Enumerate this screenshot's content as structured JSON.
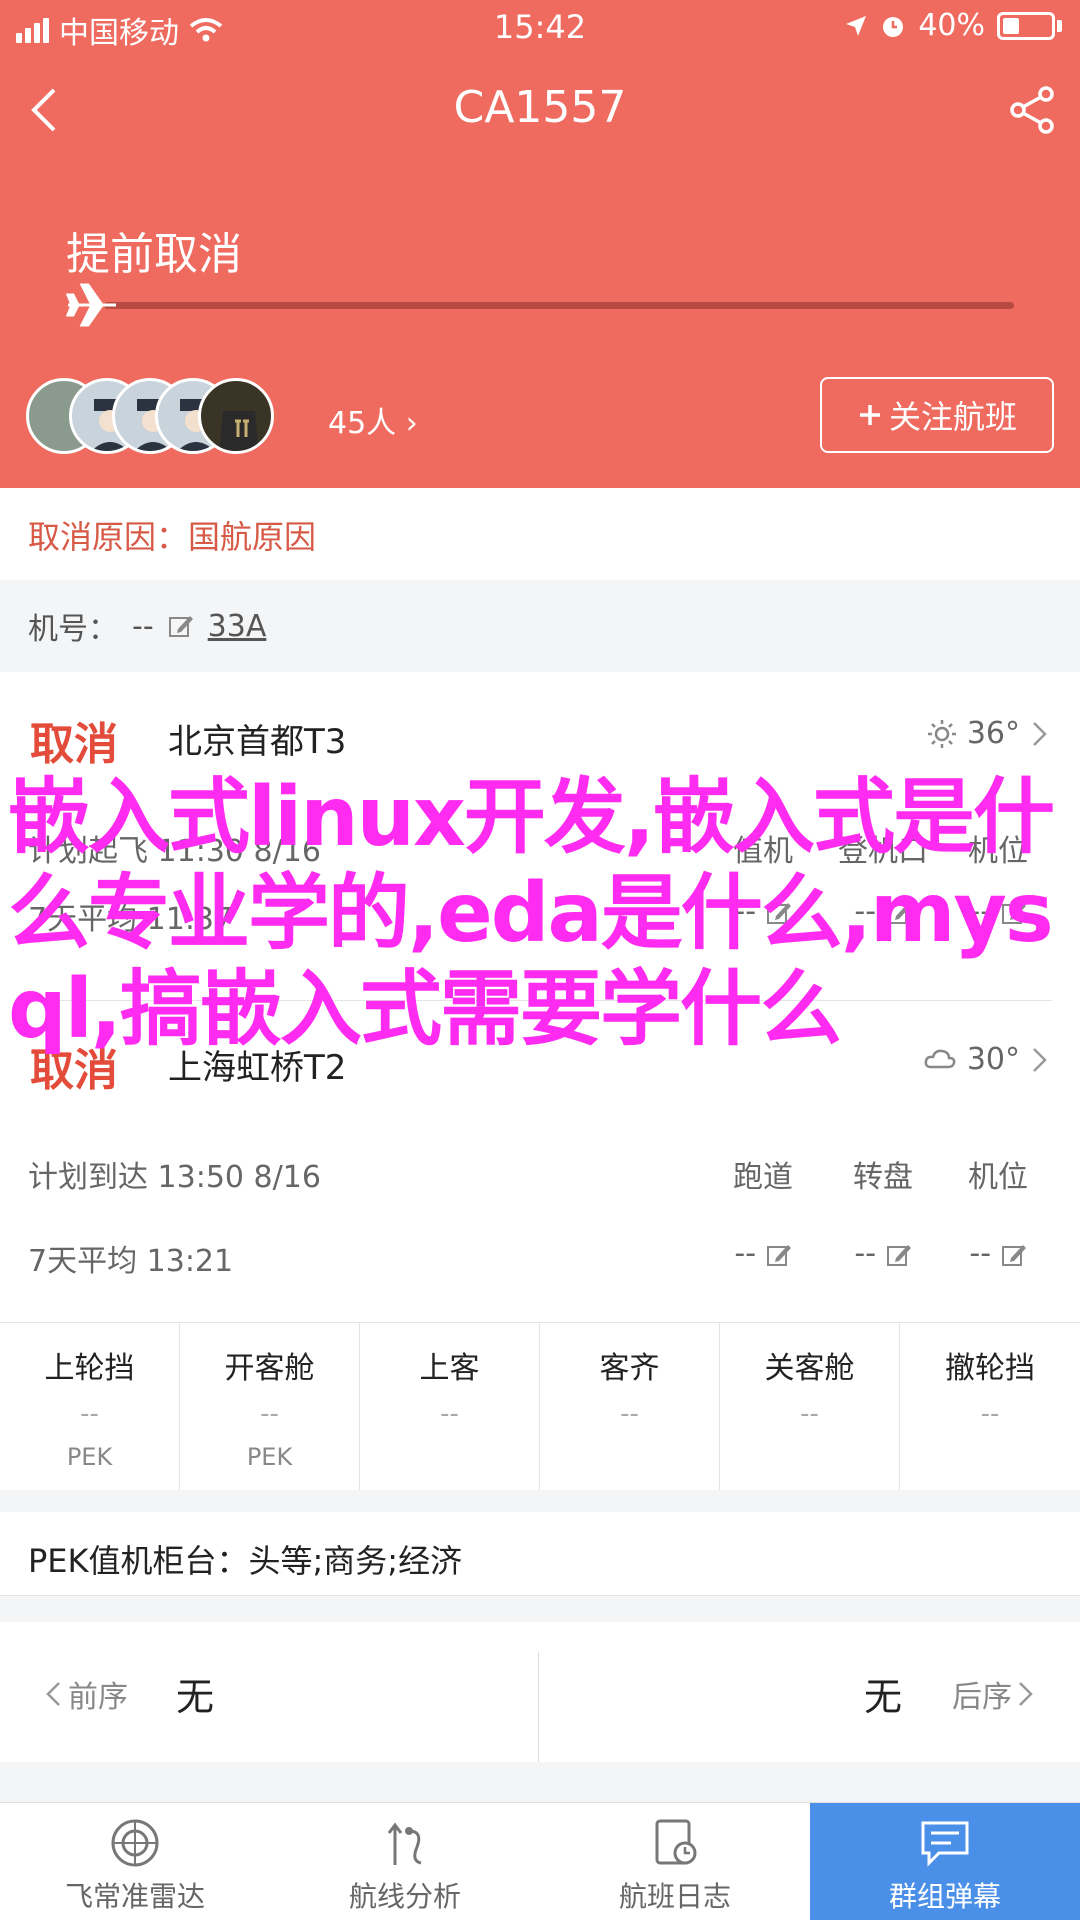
{
  "status_bar": {
    "carrier": "中国移动",
    "time": "15:42",
    "battery": "40%"
  },
  "nav": {
    "title": "CA1557"
  },
  "flight_status": {
    "label": "提前取消"
  },
  "followers": {
    "count_label": "45人",
    "follow_button": "关注航班"
  },
  "cancel_reason": {
    "label": "取消原因：",
    "value": "国航原因"
  },
  "plane_number": {
    "label": "机号：",
    "value": "--",
    "link": "33A"
  },
  "departure": {
    "status": "取消",
    "airport": "北京首都T3",
    "weather": "36°",
    "planned_label": "计划起飞",
    "planned_time": "11:30 8/16",
    "col1": "值机",
    "col2": "登机口",
    "col3": "机位",
    "avg_label": "7天平均",
    "avg_time": "11:37",
    "v1": "--",
    "v2": "--",
    "v3": "--"
  },
  "arrival": {
    "status": "取消",
    "airport": "上海虹桥T2",
    "weather": "30°",
    "planned_label": "计划到达",
    "planned_time": "13:50 8/16",
    "col1": "跑道",
    "col2": "转盘",
    "col3": "机位",
    "avg_label": "7天平均",
    "avg_time": "13:21",
    "v1": "--",
    "v2": "--",
    "v3": "--"
  },
  "status_grid": [
    {
      "label": "上轮挡",
      "value": "--",
      "sub": "PEK"
    },
    {
      "label": "开客舱",
      "value": "--",
      "sub": "PEK"
    },
    {
      "label": "上客",
      "value": "--",
      "sub": ""
    },
    {
      "label": "客齐",
      "value": "--",
      "sub": ""
    },
    {
      "label": "关客舱",
      "value": "--",
      "sub": ""
    },
    {
      "label": "撤轮挡",
      "value": "--",
      "sub": ""
    }
  ],
  "counter": {
    "label": "PEK值机柜台：",
    "value": "头等;商务;经济"
  },
  "sequence": {
    "prev_label": "前序",
    "prev_value": "无",
    "next_value": "无",
    "next_label": "后序"
  },
  "tabs": [
    {
      "label": "飞常准雷达",
      "icon": "radar-icon"
    },
    {
      "label": "航线分析",
      "icon": "route-icon"
    },
    {
      "label": "航班日志",
      "icon": "log-icon"
    },
    {
      "label": "群组弹幕",
      "icon": "chat-icon"
    }
  ],
  "overlay_text": "嵌入式linux开发,嵌入式是什么专业学的,eda是什么,mysql,搞嵌入式需要学什么",
  "colors": {
    "header": "#ef6a5f",
    "accent_red": "#e34c3a",
    "tab_active": "#4a8fe8",
    "overlay": "#ff2bf0"
  }
}
